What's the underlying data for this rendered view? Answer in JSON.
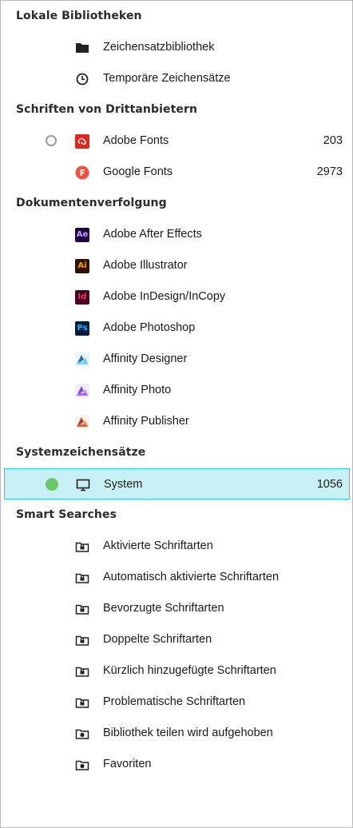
{
  "sections": {
    "local": {
      "title": "Lokale Bibliotheken",
      "items": [
        {
          "label": "Zeichensatzbibliothek",
          "icon": "folder-icon"
        },
        {
          "label": "Temporäre Zeichensätze",
          "icon": "clock-icon"
        }
      ]
    },
    "third_party": {
      "title": "Schriften von Drittanbietern",
      "items": [
        {
          "label": "Adobe Fonts",
          "count": "203",
          "icon": "adobe-fonts-icon"
        },
        {
          "label": "Google Fonts",
          "count": "2973",
          "icon": "google-fonts-icon"
        }
      ]
    },
    "tracking": {
      "title": "Dokumentenverfolgung",
      "items": [
        {
          "label": "Adobe After Effects",
          "icon": "after-effects-icon",
          "tile": "Ae",
          "bg": "#1f0740",
          "fg": "#c89cff"
        },
        {
          "label": "Adobe Illustrator",
          "icon": "illustrator-icon",
          "tile": "Ai",
          "bg": "#2e1400",
          "fg": "#ff9a00"
        },
        {
          "label": "Adobe InDesign/InCopy",
          "icon": "indesign-icon",
          "tile": "Id",
          "bg": "#49021f",
          "fg": "#ff3366"
        },
        {
          "label": "Adobe Photoshop",
          "icon": "photoshop-icon",
          "tile": "Ps",
          "bg": "#001e36",
          "fg": "#31a8ff"
        },
        {
          "label": "Affinity Designer",
          "icon": "affinity-designer-icon"
        },
        {
          "label": "Affinity Photo",
          "icon": "affinity-photo-icon"
        },
        {
          "label": "Affinity Publisher",
          "icon": "affinity-publisher-icon"
        }
      ]
    },
    "system": {
      "title": "Systemzeichensätze",
      "items": [
        {
          "label": "System",
          "count": "1056",
          "icon": "monitor-icon"
        }
      ]
    },
    "smart": {
      "title": "Smart Searches",
      "items": [
        {
          "label": "Aktivierte Schriftarten",
          "icon": "smart-folder-icon"
        },
        {
          "label": "Automatisch aktivierte Schriftarten",
          "icon": "smart-folder-icon"
        },
        {
          "label": "Bevorzugte Schriftarten",
          "icon": "smart-folder-icon"
        },
        {
          "label": "Doppelte Schriftarten",
          "icon": "smart-folder-icon"
        },
        {
          "label": "Kürzlich hinzugefügte Schriftarten",
          "icon": "smart-folder-icon"
        },
        {
          "label": "Problematische Schriftarten",
          "icon": "smart-folder-icon"
        },
        {
          "label": "Bibliothek teilen wird aufgehoben",
          "icon": "shared-folder-icon"
        },
        {
          "label": "Favoriten",
          "icon": "shared-folder-icon"
        }
      ]
    }
  },
  "colors": {
    "selection_bg": "#c9f1f5",
    "selection_border": "#2fc6d6",
    "active_dot": "#6cc76a",
    "adobe_red": "#e1251b",
    "google_fonts": "#f4513c"
  }
}
